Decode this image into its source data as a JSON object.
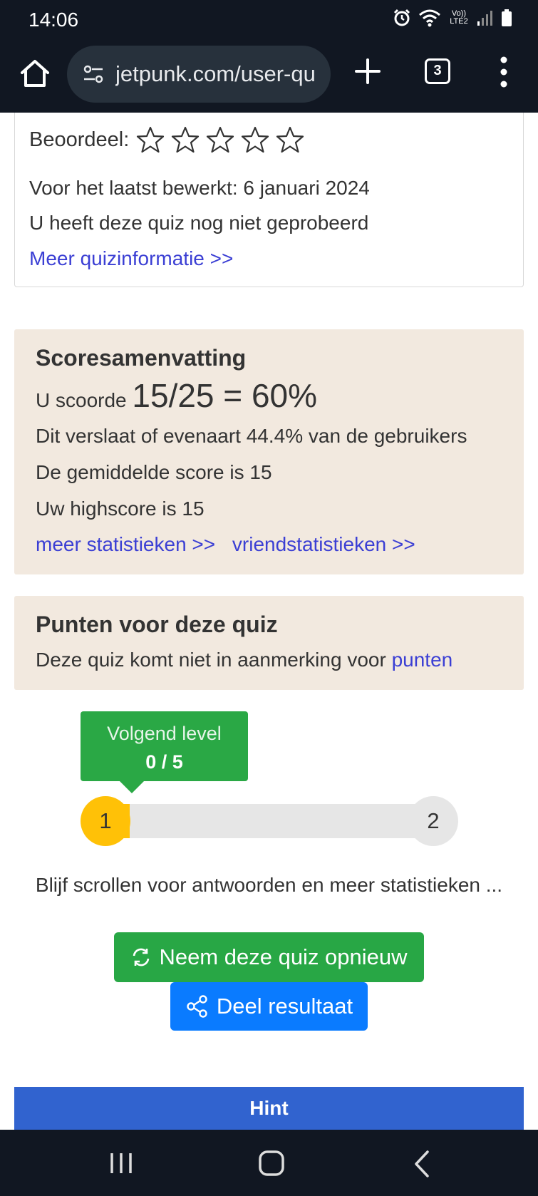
{
  "status_bar": {
    "time": "14:06",
    "network_label": "Vo)) LTE2"
  },
  "browser": {
    "url": "jetpunk.com/user-qu",
    "tab_count": "3"
  },
  "quiz_info": {
    "rating_label": "Beoordeel:",
    "rating_stars_filled": 0,
    "rating_stars_total": 5,
    "last_edited": "Voor het laatst bewerkt: 6 januari 2024",
    "attempt_status": "U heeft deze quiz nog niet geprobeerd",
    "more_info_link": "Meer quizinformatie >>"
  },
  "score_summary": {
    "title": "Scoresamenvatting",
    "score_prefix": "U scoorde",
    "score_value": "15/25 = 60%",
    "beat_text": "Dit verslaat of evenaart 44.4% van de gebruikers",
    "average_text": "De gemiddelde score is 15",
    "highscore_text": "Uw highscore is 15",
    "more_stats_link": "meer statistieken >>",
    "friend_stats_link": "vriendstatistieken >>"
  },
  "points": {
    "title": "Punten voor deze quiz",
    "text": "Deze quiz komt niet in aanmerking voor",
    "link": "punten"
  },
  "level": {
    "tooltip_label": "Volgend level",
    "tooltip_progress": "0 / 5",
    "current_level": "1",
    "next_level": "2",
    "progress_fraction": 0
  },
  "scroll_note": "Blijf scrollen voor antwoorden en meer statistieken ...",
  "buttons": {
    "retake_label": "Neem deze quiz opnieuw",
    "share_label": "Deel resultaat",
    "hint_label": "Hint"
  },
  "colors": {
    "accent_green": "#28a745",
    "accent_blue": "#0a7bff",
    "link_blue": "#3b3fd4",
    "panel_bg": "#f2e9df",
    "level_yellow": "#ffc107",
    "hint_blue": "#3163cf"
  },
  "icons": [
    "home-icon",
    "tune-icon",
    "plus-icon",
    "tabs-icon",
    "more-vert-icon",
    "star-outline-icon",
    "refresh-icon",
    "share-icon",
    "recent-apps-icon",
    "nav-home-icon",
    "nav-back-icon",
    "alarm-icon",
    "wifi-icon",
    "signal-icon",
    "battery-icon"
  ]
}
